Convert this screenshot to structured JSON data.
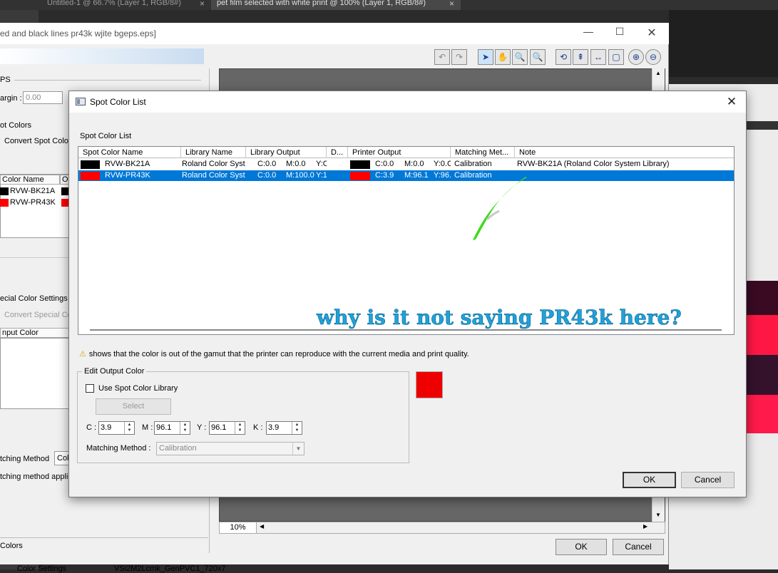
{
  "photoshop": {
    "tabs": [
      {
        "label": "Untitled-1 @ 66.7% (Layer 1, RGB/8#)",
        "active": false
      },
      {
        "label": "pet film selected with white print @ 100% (Layer 1, RGB/8#)",
        "active": true
      }
    ],
    "tab_close": "×",
    "stripe_colors": [
      "#3a0a22",
      "#ff1744",
      "#35122c",
      "#ff1a4b"
    ]
  },
  "preview_window": {
    "title": "ed and black lines pr43k wjite bgeps.eps]",
    "left_panel": {
      "eps_label": "PS",
      "margin_label": "argin :",
      "margin_value": "0.00",
      "spot_colors_label": "ot Colors",
      "convert_spot": "Convert Spot Color",
      "col_name": "Color Name",
      "col_o": "O",
      "items": [
        {
          "name": "RVW-BK21A",
          "color": "#000000"
        },
        {
          "name": "RVW-PR43K",
          "color": "#ff0000"
        }
      ],
      "special_settings": "ecial Color Settings",
      "convert_special": "Convert Special Co",
      "input_color": "nput Color",
      "matching_method": "tching Method",
      "matching_value": "Col",
      "matching_applied": "tching method applie",
      "colors_label": "Colors",
      "color_settings": "Color Settings",
      "settings_value": "VSi2M2Lcmk_GenPVC1_720x7"
    },
    "zoom": "10%",
    "ok": "OK",
    "cancel": "Cancel"
  },
  "dialog": {
    "title": "Spot Color List",
    "group_label": "Spot Color List",
    "columns": [
      "Spot Color Name",
      "Library Name",
      "Library Output",
      "D...",
      "Printer Output",
      "Matching Met...",
      "Note"
    ],
    "rows": [
      {
        "name": "RVW-BK21A",
        "swatch": "#000000",
        "library": "Roland Color Syste",
        "lib_c": "C:0.0",
        "lib_m": "M:0.0",
        "lib_y": "Y:C",
        "out_swatch": "#000000",
        "out_c": "C:0.0",
        "out_m": "M:0.0",
        "out_y": "Y:0.C",
        "matching": "Calibration",
        "note": "RVW-BK21A (Roland Color System Library)",
        "selected": false
      },
      {
        "name": "RVW-PR43K",
        "swatch": "#ff0000",
        "library": "Roland Color Syste",
        "lib_c": "C:0.0",
        "lib_m": "M:100.0",
        "lib_y": "Y:1",
        "out_swatch": "#ff0000",
        "out_c": "C:3.9",
        "out_m": "M:96.1",
        "out_y": "Y:96.",
        "matching": "Calibration",
        "note": "",
        "selected": true
      }
    ],
    "annotation": "why is it not saying PR43k here?",
    "annotation_color": "#1fa2d8",
    "stroke_color": "#3ddb1c",
    "gamut_note": "shows that the color is out of the gamut that the printer can reproduce with the current media and print quality.",
    "edit": {
      "legend": "Edit Output Color",
      "use_library": "Use Spot Color Library",
      "select": "Select",
      "c_label": "C :",
      "c": "3.9",
      "m_label": "M :",
      "m": "96.1",
      "y_label": "Y :",
      "y": "96.1",
      "k_label": "K :",
      "k": "3.9",
      "matching_label": "Matching Method :",
      "matching_value": "Calibration",
      "preview_color": "#ee0000"
    },
    "ok": "OK",
    "cancel": "Cancel"
  }
}
